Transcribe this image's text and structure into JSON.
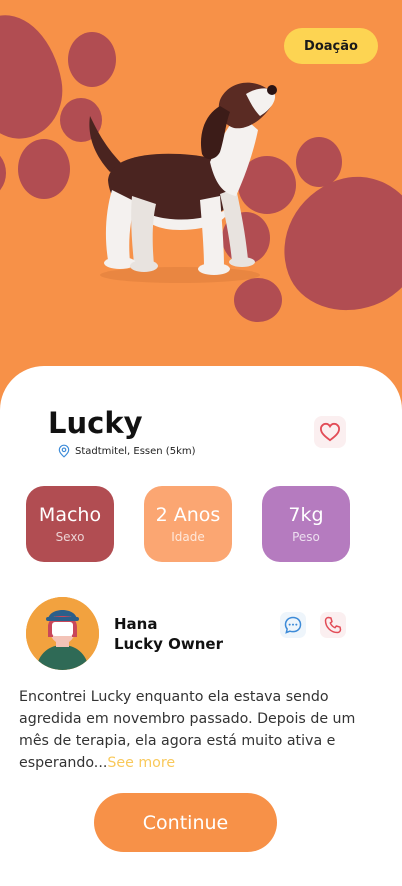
{
  "header": {
    "donation_badge": "Doação"
  },
  "pet": {
    "name": "Lucky",
    "location": "Stadtmitel, Essen (5km)",
    "stats": [
      {
        "value": "Macho",
        "label": "Sexo",
        "color": "#B14D52"
      },
      {
        "value": "2 Anos",
        "label": "Idade",
        "color": "#FBA672"
      },
      {
        "value": "7kg",
        "label": "Peso",
        "color": "#B57BBF"
      }
    ],
    "description": "Encontrei Lucky enquanto ela estava sendo agredida em novembro passado. Depois de um mês de terapia, ela agora está muito ativa e esperando...",
    "see_more": "See more"
  },
  "owner": {
    "name": "Hana",
    "role": "Lucky Owner"
  },
  "actions": {
    "continue_label": "Continue"
  },
  "icons": [
    "heart-icon",
    "location-pin-icon",
    "chat-icon",
    "phone-icon"
  ],
  "colors": {
    "background": "#F79148",
    "paw": "#B14D52",
    "badge": "#FDD452",
    "see_more": "#F9C95B"
  }
}
